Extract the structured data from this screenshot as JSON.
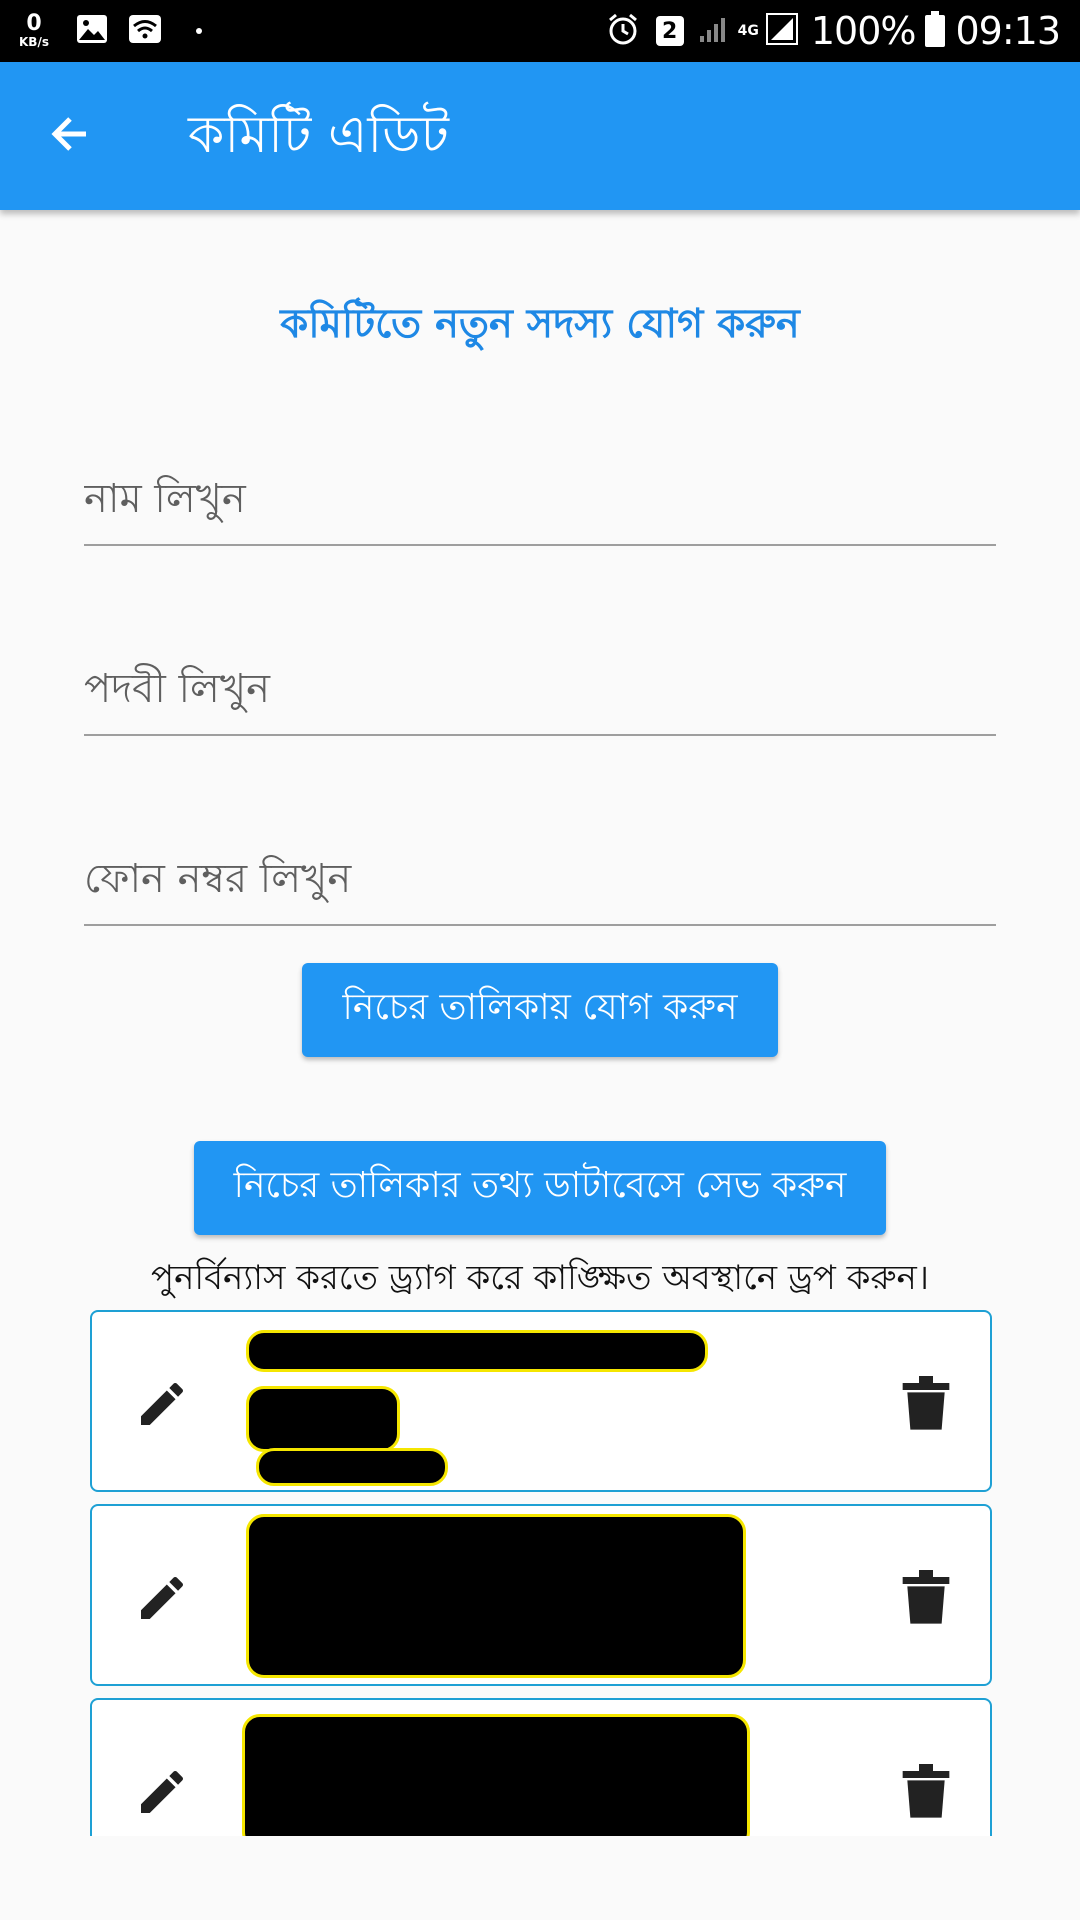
{
  "status_bar": {
    "speed_value": "0",
    "speed_unit": "KB/s",
    "sim_slot": "2",
    "network": "4G",
    "battery": "100%",
    "time": "09:13"
  },
  "app_bar": {
    "title": "কমিটি এডিট",
    "color": "#2196f3"
  },
  "form": {
    "heading": "কমিটিতে নতুন সদস্য যোগ করুন",
    "name_placeholder": "নাম লিখুন",
    "name_value": "",
    "designation_placeholder": "পদবী লিখুন",
    "designation_value": "",
    "phone_placeholder": "ফোন নম্বর লিখুন",
    "phone_value": ""
  },
  "buttons": {
    "add_to_list": "নিচের তালিকায় যোগ করুন",
    "save_to_database": "নিচের তালিকার তথ্য ডাটাবেসে সেভ করুন"
  },
  "hint": "পুনর্বিন্যাস করতে ড্র্যাগ করে কাঙ্ক্ষিত অবস্থানে ড্রপ করুন।",
  "members": [
    {
      "redacted": true
    },
    {
      "redacted": true
    },
    {
      "redacted": true
    }
  ],
  "icons": {
    "back": "arrow-back-icon",
    "edit": "pencil-icon",
    "delete": "trash-icon"
  }
}
